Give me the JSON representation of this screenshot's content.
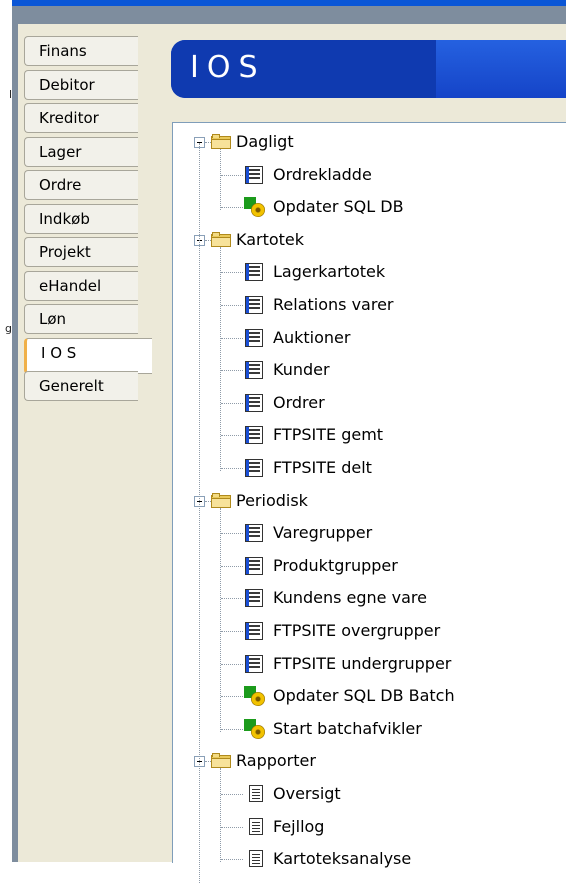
{
  "left_fragments": [
    "l",
    "g"
  ],
  "tabs": [
    {
      "label": "Finans"
    },
    {
      "label": "Debitor"
    },
    {
      "label": "Kreditor"
    },
    {
      "label": "Lager"
    },
    {
      "label": "Ordre"
    },
    {
      "label": "Indkøb"
    },
    {
      "label": "Projekt"
    },
    {
      "label": "eHandel"
    },
    {
      "label": "Løn"
    },
    {
      "label": "I O S",
      "active": true
    },
    {
      "label": "Generelt"
    }
  ],
  "banner": {
    "title": "IOS"
  },
  "tree": {
    "folders": [
      {
        "label": "Dagligt",
        "items": [
          {
            "label": "Ordrekladde",
            "icon": "form-icon"
          },
          {
            "label": "Opdater SQL DB",
            "icon": "batch-icon"
          }
        ]
      },
      {
        "label": "Kartotek",
        "items": [
          {
            "label": "Lagerkartotek",
            "icon": "form-icon"
          },
          {
            "label": "Relations varer",
            "icon": "form-icon"
          },
          {
            "label": "Auktioner",
            "icon": "form-icon"
          },
          {
            "label": "Kunder",
            "icon": "form-icon"
          },
          {
            "label": "Ordrer",
            "icon": "form-icon"
          },
          {
            "label": "FTPSITE gemt",
            "icon": "form-icon"
          },
          {
            "label": "FTPSITE delt",
            "icon": "form-icon"
          }
        ]
      },
      {
        "label": "Periodisk",
        "items": [
          {
            "label": "Varegrupper",
            "icon": "form-icon"
          },
          {
            "label": "Produktgrupper",
            "icon": "form-icon"
          },
          {
            "label": "Kundens egne vare",
            "icon": "form-icon"
          },
          {
            "label": "FTPSITE overgrupper",
            "icon": "form-icon"
          },
          {
            "label": "FTPSITE undergrupper",
            "icon": "form-icon"
          },
          {
            "label": "Opdater SQL DB Batch",
            "icon": "batch-icon"
          },
          {
            "label": "Start batchafvikler",
            "icon": "batch-icon"
          }
        ]
      },
      {
        "label": "Rapporter",
        "items": [
          {
            "label": "Oversigt",
            "icon": "report-icon"
          },
          {
            "label": "Fejllog",
            "icon": "report-icon"
          },
          {
            "label": "Kartoteksanalyse",
            "icon": "report-icon"
          }
        ]
      }
    ]
  }
}
